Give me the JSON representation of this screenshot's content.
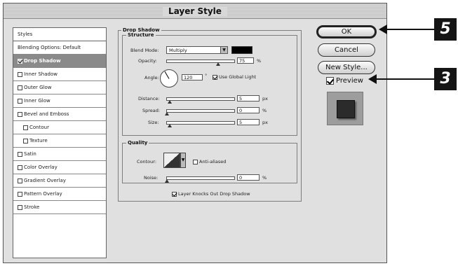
{
  "window": {
    "title": "Layer Style"
  },
  "styles_list": [
    {
      "label": "Styles",
      "has_checkbox": false,
      "checked": false,
      "selected": false,
      "sub": false
    },
    {
      "label": "Blending Options: Default",
      "has_checkbox": false,
      "checked": false,
      "selected": false,
      "sub": false
    },
    {
      "label": "Drop Shadow",
      "has_checkbox": true,
      "checked": true,
      "selected": true,
      "sub": false
    },
    {
      "label": "Inner Shadow",
      "has_checkbox": true,
      "checked": false,
      "selected": false,
      "sub": false
    },
    {
      "label": "Outer Glow",
      "has_checkbox": true,
      "checked": false,
      "selected": false,
      "sub": false
    },
    {
      "label": "Inner Glow",
      "has_checkbox": true,
      "checked": false,
      "selected": false,
      "sub": false
    },
    {
      "label": "Bevel and Emboss",
      "has_checkbox": true,
      "checked": false,
      "selected": false,
      "sub": false
    },
    {
      "label": "Contour",
      "has_checkbox": true,
      "checked": false,
      "selected": false,
      "sub": true
    },
    {
      "label": "Texture",
      "has_checkbox": true,
      "checked": false,
      "selected": false,
      "sub": true
    },
    {
      "label": "Satin",
      "has_checkbox": true,
      "checked": false,
      "selected": false,
      "sub": false
    },
    {
      "label": "Color Overlay",
      "has_checkbox": true,
      "checked": false,
      "selected": false,
      "sub": false
    },
    {
      "label": "Gradient Overlay",
      "has_checkbox": true,
      "checked": false,
      "selected": false,
      "sub": false
    },
    {
      "label": "Pattern Overlay",
      "has_checkbox": true,
      "checked": false,
      "selected": false,
      "sub": false
    },
    {
      "label": "Stroke",
      "has_checkbox": true,
      "checked": false,
      "selected": false,
      "sub": false
    }
  ],
  "drop_shadow": {
    "title": "Drop Shadow",
    "structure": {
      "title": "Structure",
      "blend_mode_label": "Blend Mode:",
      "blend_mode_value": "Multiply",
      "shadow_color": "#000000",
      "opacity_label": "Opacity:",
      "opacity_value": "75",
      "opacity_fraction": 0.75,
      "percent_unit": "%",
      "angle_label": "Angle:",
      "angle_value": "120",
      "degree_unit": "°",
      "global_light_label": "Use Global Light",
      "global_light_checked": true,
      "distance_label": "Distance:",
      "distance_value": "5",
      "spread_label": "Spread:",
      "spread_value": "0",
      "size_label": "Size:",
      "size_value": "5",
      "px_unit": "px"
    },
    "quality": {
      "title": "Quality",
      "contour_label": "Contour:",
      "anti_aliased_label": "Anti-aliased",
      "anti_aliased_checked": false,
      "noise_label": "Noise:",
      "noise_value": "0",
      "percent_unit": "%"
    },
    "knockout_label": "Layer Knocks Out Drop Shadow",
    "knockout_checked": true
  },
  "buttons": {
    "ok": "OK",
    "cancel": "Cancel",
    "new_style": "New Style...",
    "preview_label": "Preview",
    "preview_checked": true
  },
  "callouts": {
    "ok_step": "5",
    "preview_step": "3"
  },
  "icons": [
    "checkmark-icon",
    "dropdown-arrow-icon",
    "angle-dial-icon",
    "contour-curve-icon",
    "arrow-left-icon"
  ]
}
